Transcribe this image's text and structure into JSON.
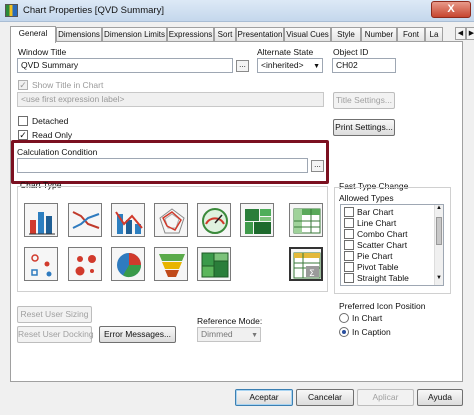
{
  "window": {
    "title": "Chart Properties [QVD Summary]",
    "close_glyph": "X"
  },
  "tabs": [
    {
      "label": "General"
    },
    {
      "label": "Dimensions"
    },
    {
      "label": "Dimension Limits"
    },
    {
      "label": "Expressions"
    },
    {
      "label": "Sort"
    },
    {
      "label": "Presentation"
    },
    {
      "label": "Visual Cues"
    },
    {
      "label": "Style"
    },
    {
      "label": "Number"
    },
    {
      "label": "Font"
    },
    {
      "label": "La"
    }
  ],
  "general": {
    "window_title_label": "Window Title",
    "window_title_value": "QVD Summary",
    "alternate_state_label": "Alternate State",
    "alternate_state_value": "<inherited>",
    "object_id_label": "Object ID",
    "object_id_value": "CH02",
    "show_title_label": "Show Title in Chart",
    "title_placeholder": "<use first expression label>",
    "title_settings_label": "Title Settings...",
    "detached_label": "Detached",
    "read_only_label": "Read Only",
    "print_settings_label": "Print Settings...",
    "calc_condition_label": "Calculation Condition",
    "calc_condition_value": "",
    "ellipsis": "...",
    "chart_type_label": "Chart Type",
    "fast_type_label": "Fast Type Change",
    "allowed_types_label": "Allowed Types",
    "allowed_types": [
      {
        "label": "Bar Chart"
      },
      {
        "label": "Line Chart"
      },
      {
        "label": "Combo Chart"
      },
      {
        "label": "Scatter Chart"
      },
      {
        "label": "Pie Chart"
      },
      {
        "label": "Pivot Table"
      },
      {
        "label": "Straight Table"
      }
    ],
    "icon_position_label": "Preferred Icon Position",
    "icon_position_options": [
      {
        "label": "In Chart",
        "selected": false
      },
      {
        "label": "In Caption",
        "selected": true
      }
    ],
    "reset_user_sizing_label": "Reset User Sizing",
    "reset_user_docking_label": "Reset User Docking",
    "error_messages_label": "Error Messages...",
    "reference_mode_label": "Reference Mode:",
    "reference_mode_value": "Dimmed"
  },
  "footer": {
    "accept_label": "Aceptar",
    "cancel_label": "Cancelar",
    "apply_label": "Aplicar",
    "help_label": "Ayuda"
  },
  "chart_types": [
    {
      "icon": "bar-chart-icon"
    },
    {
      "icon": "line-chart-icon"
    },
    {
      "icon": "combo-chart-icon"
    },
    {
      "icon": "radar-chart-icon"
    },
    {
      "icon": "gauge-chart-icon"
    },
    {
      "icon": "block-chart-icon"
    },
    {
      "icon": "pivot-table-icon"
    },
    {
      "icon": "scatter-chart-icon"
    },
    {
      "icon": "grid-chart-icon"
    },
    {
      "icon": "pie-chart-icon"
    },
    {
      "icon": "funnel-chart-icon"
    },
    {
      "icon": "mekko-chart-icon"
    },
    {
      "icon": "straight-table-icon"
    }
  ],
  "colors": {
    "highlight": "#7b1020",
    "selection": "#2a4f9e"
  }
}
